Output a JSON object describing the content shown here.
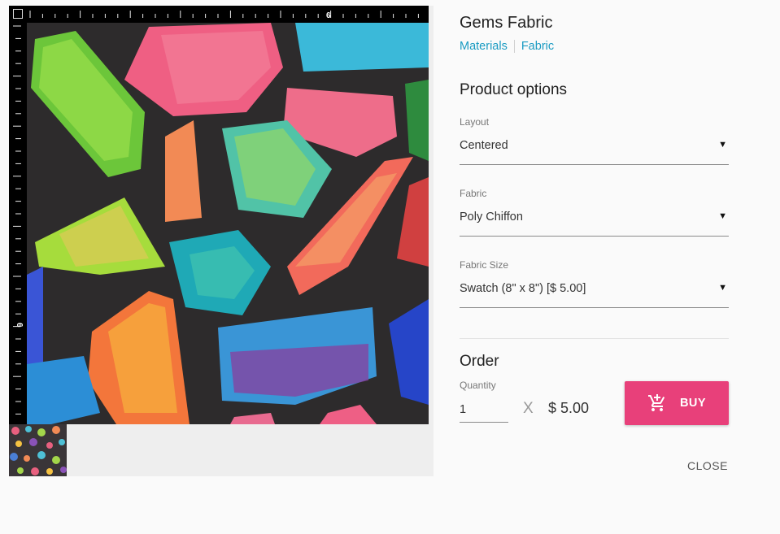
{
  "product": {
    "title": "Gems Fabric",
    "breadcrumbs": [
      "Materials",
      "Fabric"
    ]
  },
  "preview": {
    "ruler_top_mark": "6",
    "ruler_left_mark": "6",
    "background_color": "#2d2b2c"
  },
  "options": {
    "heading": "Product options",
    "layout": {
      "label": "Layout",
      "value": "Centered"
    },
    "fabric": {
      "label": "Fabric",
      "value": "Poly Chiffon"
    },
    "fabric_size": {
      "label": "Fabric Size",
      "value": "Swatch (8\" x 8\") [$ 5.00]"
    }
  },
  "order": {
    "heading": "Order",
    "quantity_label": "Quantity",
    "quantity_value": "1",
    "times": "X",
    "price": "$ 5.00",
    "buy_label": "BUY",
    "buy_icon": "add-shopping-cart-icon"
  },
  "close_label": "CLOSE",
  "colors": {
    "accent_link": "#1a9bc2",
    "buy_button": "#e8407a"
  }
}
